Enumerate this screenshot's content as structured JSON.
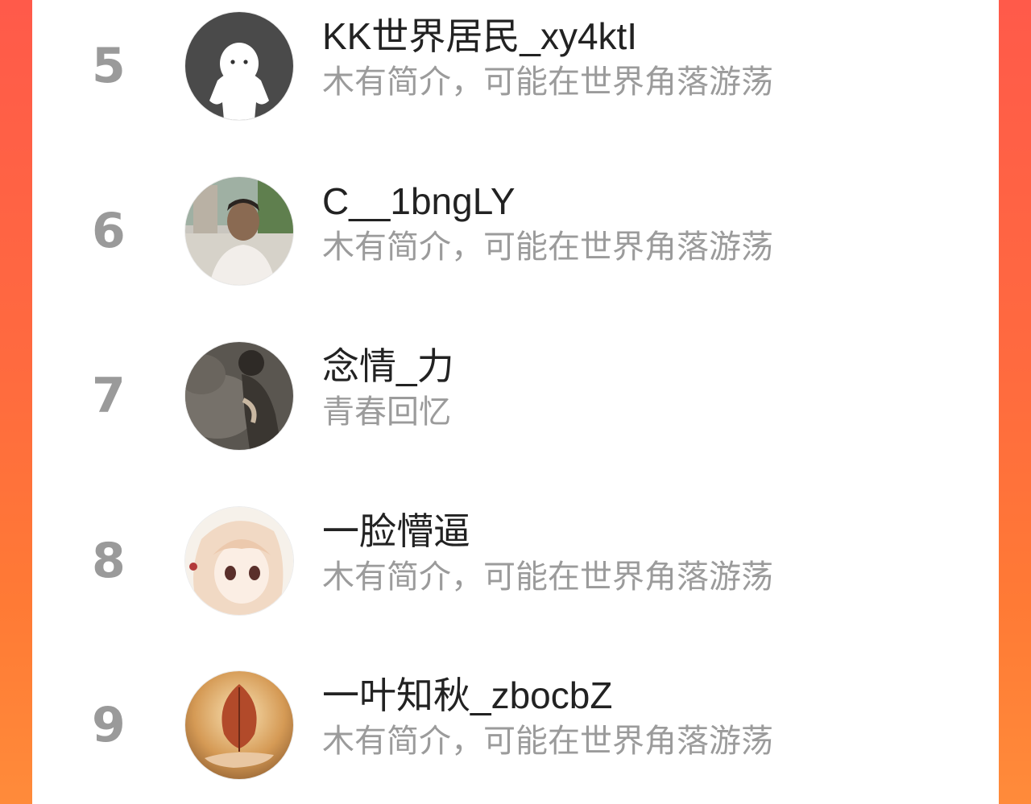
{
  "colors": {
    "background_left": "#ff5a4a",
    "background_right": "#ff8b3a",
    "panel": "#ffffff",
    "rank": "#9a9a9a",
    "name": "#222222",
    "bio": "#9b9b9b"
  },
  "users": [
    {
      "rank": "5",
      "name": "KK世界居民_xy4ktI",
      "bio": "木有简介，可能在世界角落游荡",
      "avatar": "default-ghost-avatar"
    },
    {
      "rank": "6",
      "name": "C__1bngLY",
      "bio": "木有简介，可能在世界角落游荡",
      "avatar": "man-photo-avatar"
    },
    {
      "rank": "7",
      "name": "念情_力",
      "bio": "青春回忆",
      "avatar": "sitting-person-photo-avatar"
    },
    {
      "rank": "8",
      "name": "一脸懵逼",
      "bio": "木有简介，可能在世界角落游荡",
      "avatar": "anime-girl-avatar"
    },
    {
      "rank": "9",
      "name": "一叶知秋_zbocbZ",
      "bio": "木有简介，可能在世界角落游荡",
      "avatar": "leaf-in-hand-avatar"
    }
  ]
}
